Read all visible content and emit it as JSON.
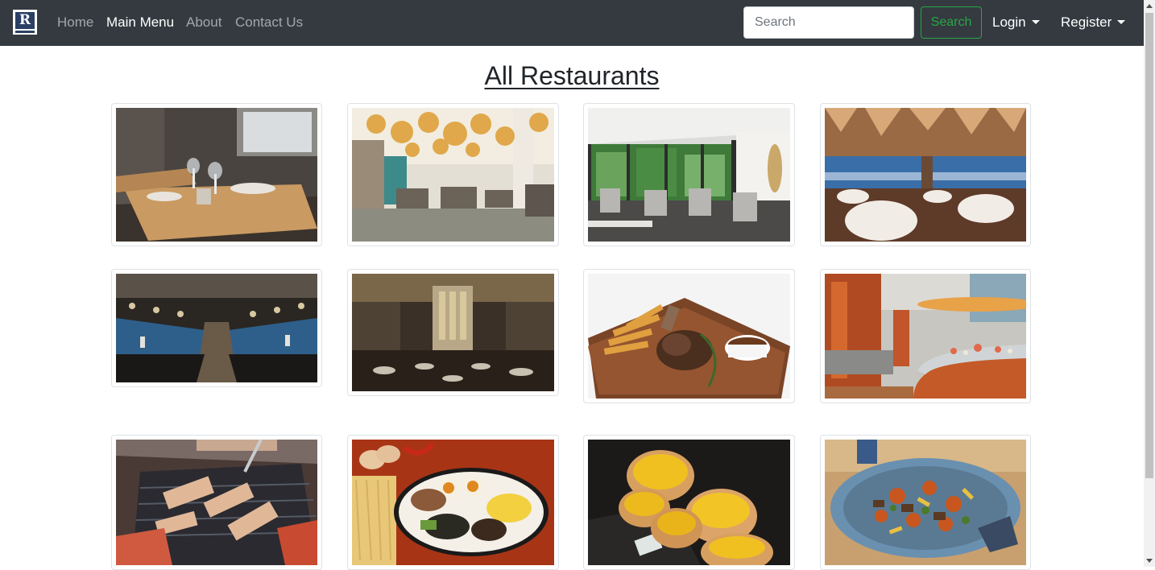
{
  "navbar": {
    "brand_letter": "R",
    "links": {
      "home": "Home",
      "main_menu": "Main Menu",
      "about": "About",
      "contact": "Contact Us"
    },
    "active_link": "Main Menu",
    "search": {
      "placeholder": "Search",
      "button_label": "Search"
    },
    "login_label": "Login",
    "register_label": "Register"
  },
  "page": {
    "title": "All Restaurants"
  },
  "restaurants": [
    {
      "image": "restaurant-interior-wooden-tables-photo"
    },
    {
      "image": "restaurant-interior-chandeliers-photo"
    },
    {
      "image": "restaurant-interior-garden-view-photo"
    },
    {
      "image": "restaurant-interior-city-view-photo"
    },
    {
      "image": "open-kitchen-counter-photo"
    },
    {
      "image": "grand-dining-hall-photo"
    },
    {
      "image": "lamb-chop-with-fries-photo"
    },
    {
      "image": "buffet-counter-photo"
    },
    {
      "image": "korean-bbq-grill-photo"
    },
    {
      "image": "ramen-bowl-photo"
    },
    {
      "image": "egg-tarts-photo"
    },
    {
      "image": "stir-fried-dish-photo"
    }
  ],
  "colors": {
    "navbar_bg": "#343a40",
    "search_button": "#28a745",
    "logo_bg": "#2a3f63"
  }
}
